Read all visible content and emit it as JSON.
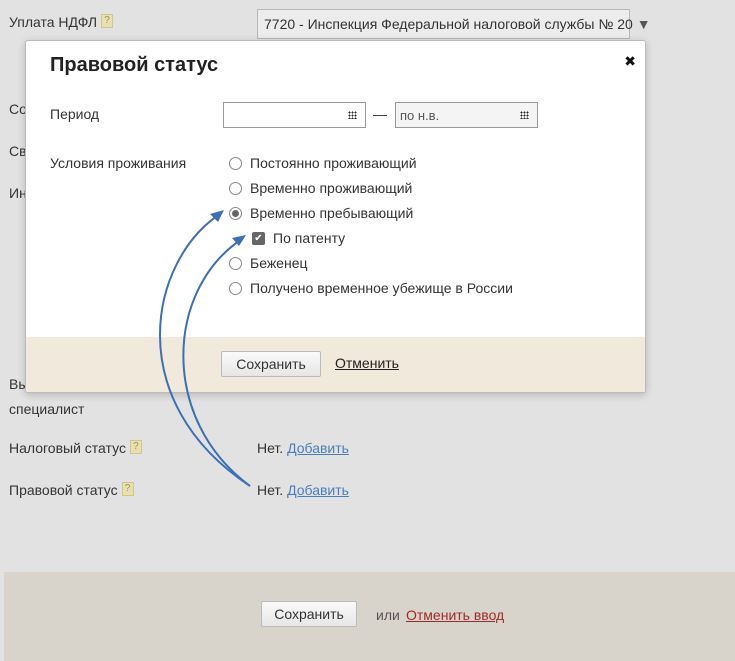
{
  "form": {
    "ndfl_label": "Уплата НДФЛ",
    "ndfl_value": "7720 - Инспекция Федеральной налоговой службы № 20",
    "help": "?",
    "partial_labels": [
      "Со",
      "Св",
      "Ин",
      "Вы"
    ],
    "specialist": "специалист",
    "tax_status_label": "Налоговый статус",
    "legal_status_label": "Правовой статус",
    "none_text": "Нет.",
    "add_link": "Добавить"
  },
  "modal": {
    "title": "Правовой статус",
    "close": "✖",
    "period_label": "Период",
    "period_from": "",
    "dash": "—",
    "period_to": "по н.в.",
    "conditions_label": "Условия проживания",
    "options": [
      {
        "label": "Постоянно проживающий",
        "selected": false
      },
      {
        "label": "Временно проживающий",
        "selected": false
      },
      {
        "label": "Временно пребывающий",
        "selected": true
      },
      {
        "label": "Беженец",
        "selected": false
      },
      {
        "label": "Получено временное убежище в России",
        "selected": false
      }
    ],
    "patent_label": "По патенту",
    "patent_checked": true,
    "save": "Сохранить",
    "cancel": "Отменить"
  },
  "footer": {
    "save": "Сохранить",
    "or": "или",
    "cancel": "Отменить ввод"
  },
  "colors": {
    "arrow": "#3c6fb3",
    "link": "#4a7fb8",
    "cancel_link": "#9b2b2b"
  }
}
